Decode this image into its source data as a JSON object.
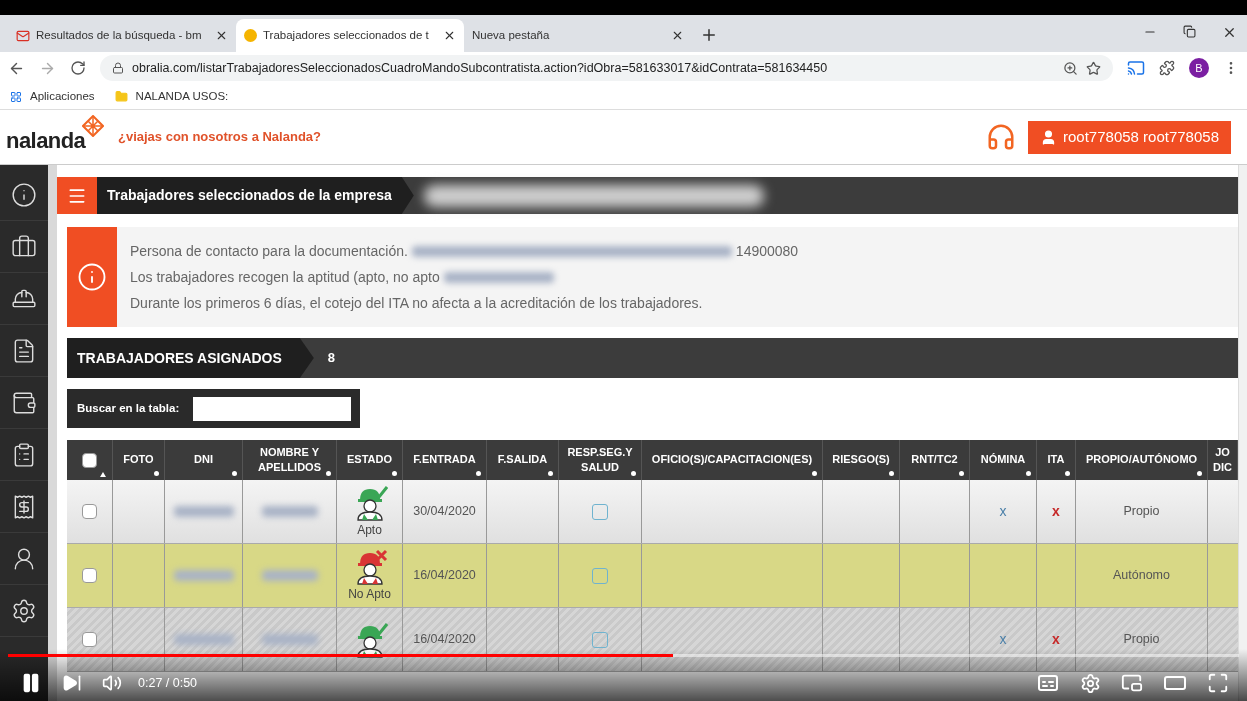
{
  "browser": {
    "tabs": [
      {
        "title": "Resultados de la búsqueda - bm",
        "kind": "mail",
        "selected": false
      },
      {
        "title": "Trabajadores seleccionados de t",
        "kind": "site",
        "selected": true
      },
      {
        "title": "Nueva pestaña",
        "kind": "blank",
        "selected": false
      }
    ],
    "url": "obralia.com/listarTrabajadoresSeleccionadosCuadroMandoSubcontratista.action?idObra=581633017&idContrata=581634450",
    "profile_initial": "B",
    "bookmarks": [
      {
        "label": "Aplicaciones",
        "kind": "apps"
      },
      {
        "label": "NALANDA USOS:",
        "kind": "folder"
      }
    ]
  },
  "header": {
    "logo": "nalanda",
    "tagline": "¿viajas con nosotros a Nalanda?",
    "user": "root778058 root778058"
  },
  "breadcrumb": {
    "title": "Trabajadores seleccionados de la empresa",
    "redacted": true
  },
  "info": {
    "lines": [
      [
        {
          "kind": "text",
          "text": "Persona de contacto para la documentación."
        },
        {
          "kind": "redacted"
        },
        {
          "kind": "text",
          "text": "14900080"
        }
      ],
      [
        {
          "kind": "text",
          "text": "Los trabajadores recogen la aptitud (apto, no apto"
        },
        {
          "kind": "redacted"
        }
      ],
      [
        {
          "kind": "text",
          "text": "Durante los primeros 6 días, el cotejo del ITA no afecta a la acreditación de los trabajadores."
        }
      ]
    ]
  },
  "section": {
    "title": "TRABAJADORES ASIGNADOS",
    "count": "8"
  },
  "search": {
    "label": "Buscar en la tabla:"
  },
  "table": {
    "select_all_checked": false,
    "columns": [
      "FOTO",
      "DNI",
      "NOMBRE Y APELLIDOS",
      "ESTADO",
      "F.ENTRADA",
      "F.SALIDA",
      "RESP.SEG.Y SALUD",
      "OFICIO(S)/CAPACITACION(ES)",
      "RIESGO(S)",
      "RNT/TC2",
      "NÓMINA",
      "ITA",
      "PROPIO/AUTÓNOMO",
      "JO DIC"
    ],
    "rows": [
      {
        "kind": "plain",
        "checked": false,
        "estado": {
          "kind": "apto",
          "label": "Apto"
        },
        "entrada": "30/04/2020",
        "resp_checked": false,
        "nomina": "x",
        "ita": "x",
        "tipo": "Propio"
      },
      {
        "kind": "highlighted",
        "checked": false,
        "estado": {
          "kind": "no_apto",
          "label": "No Apto"
        },
        "entrada": "16/04/2020",
        "resp_checked": false,
        "tipo": "Autónomo"
      },
      {
        "kind": "inactive",
        "checked": false,
        "estado": {
          "kind": "apto"
        },
        "entrada": "16/04/2020",
        "resp_checked": false,
        "nomina": "x",
        "ita": "x",
        "tipo": "Propio"
      }
    ]
  },
  "video": {
    "time": "0:27 / 0:50",
    "level": 0.54,
    "playing": true
  }
}
